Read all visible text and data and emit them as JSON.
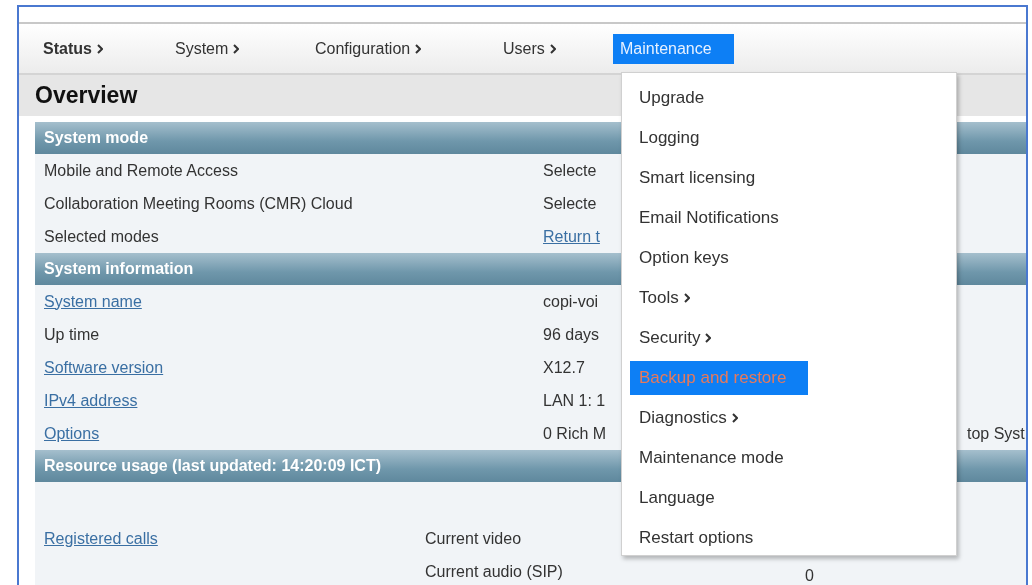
{
  "nav": [
    {
      "label": "Status",
      "submenu": true,
      "bold": true,
      "selected": false
    },
    {
      "label": "System",
      "submenu": true,
      "bold": false,
      "selected": false
    },
    {
      "label": "Configuration",
      "submenu": true,
      "bold": false,
      "selected": false
    },
    {
      "label": "Users",
      "submenu": true,
      "bold": false,
      "selected": false
    },
    {
      "label": "Maintenance",
      "submenu": false,
      "bold": false,
      "selected": true
    }
  ],
  "page_title": "Overview",
  "sections": [
    {
      "title": "System mode",
      "rows": [
        {
          "label": "Mobile and Remote Access",
          "link": false,
          "value": "Selecte"
        },
        {
          "label": "Collaboration Meeting Rooms (CMR) Cloud",
          "link": false,
          "value": "Selecte"
        },
        {
          "label": "Selected modes",
          "link": false,
          "value": "Return t",
          "value_link": true
        }
      ]
    },
    {
      "title": "System information",
      "rows": [
        {
          "label": "System name",
          "link": true,
          "value": "copi-voi"
        },
        {
          "label": "Up time",
          "link": false,
          "value": "96 days"
        },
        {
          "label": "Software version",
          "link": true,
          "value": "X12.7"
        },
        {
          "label": "IPv4 address",
          "link": true,
          "value": "LAN 1: 1"
        },
        {
          "label": "Options",
          "link": true,
          "value": "0 Rich M",
          "tail": "top Syst"
        }
      ]
    },
    {
      "title": "Resource usage (last updated: 14:20:09 ICT)",
      "kind": "usage",
      "rows": [
        {
          "label": "Registered calls",
          "link": true,
          "metric": "Current video"
        },
        {
          "metric": "Current audio (SIP)",
          "value": "0"
        }
      ]
    }
  ],
  "menu": [
    {
      "label": "Upgrade",
      "submenu": false,
      "selected": false
    },
    {
      "label": "Logging",
      "submenu": false,
      "selected": false
    },
    {
      "label": "Smart licensing",
      "submenu": false,
      "selected": false
    },
    {
      "label": "Email Notifications",
      "submenu": false,
      "selected": false
    },
    {
      "label": "Option keys",
      "submenu": false,
      "selected": false
    },
    {
      "label": "Tools",
      "submenu": true,
      "selected": false
    },
    {
      "label": "Security",
      "submenu": true,
      "selected": false
    },
    {
      "label": "Backup and restore",
      "submenu": false,
      "selected": true
    },
    {
      "label": "Diagnostics",
      "submenu": true,
      "selected": false
    },
    {
      "label": "Maintenance mode",
      "submenu": false,
      "selected": false
    },
    {
      "label": "Language",
      "submenu": false,
      "selected": false
    },
    {
      "label": "Restart options",
      "submenu": false,
      "selected": false
    }
  ]
}
